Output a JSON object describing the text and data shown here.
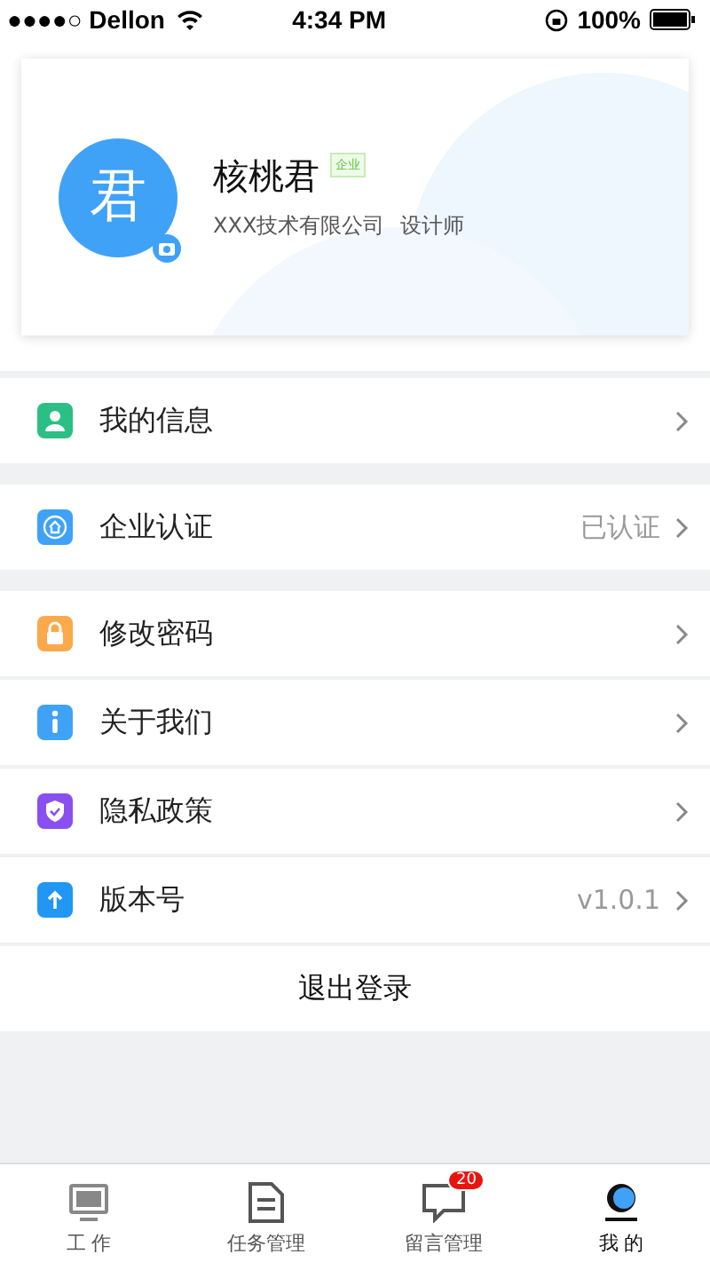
{
  "status_bar": {
    "carrier": "●●●●○ Dellon",
    "time": "4:34 PM",
    "battery": "100%"
  },
  "profile": {
    "avatar_char": "君",
    "name": "核桃君",
    "badge": "企业",
    "company": "XXX技术有限公司",
    "role": "设计师"
  },
  "menu_groups": [
    [
      {
        "kind": "person",
        "label": "我的信息",
        "color": "#2bbf86"
      }
    ],
    [
      {
        "kind": "company",
        "label": "企业认证",
        "value": "已认证",
        "color": "#3fa2f7"
      }
    ],
    [
      {
        "kind": "lock",
        "label": "修改密码",
        "color": "#fba94b"
      },
      {
        "kind": "info",
        "label": "关于我们",
        "color": "#3fa2f7"
      },
      {
        "kind": "shield",
        "label": "隐私政策",
        "color": "#8a4ff0"
      },
      {
        "kind": "upload",
        "label": "版本号",
        "value": "v1.0.1",
        "color": "#2196f3"
      }
    ]
  ],
  "logout": "退出登录",
  "tabs": [
    {
      "kind": "monitor",
      "label": "工 作",
      "selected": false
    },
    {
      "kind": "document",
      "label": "任务管理",
      "selected": false
    },
    {
      "kind": "message",
      "label": "留言管理",
      "selected": false,
      "badge": "20"
    },
    {
      "kind": "profile",
      "label": "我 的",
      "selected": true
    }
  ]
}
